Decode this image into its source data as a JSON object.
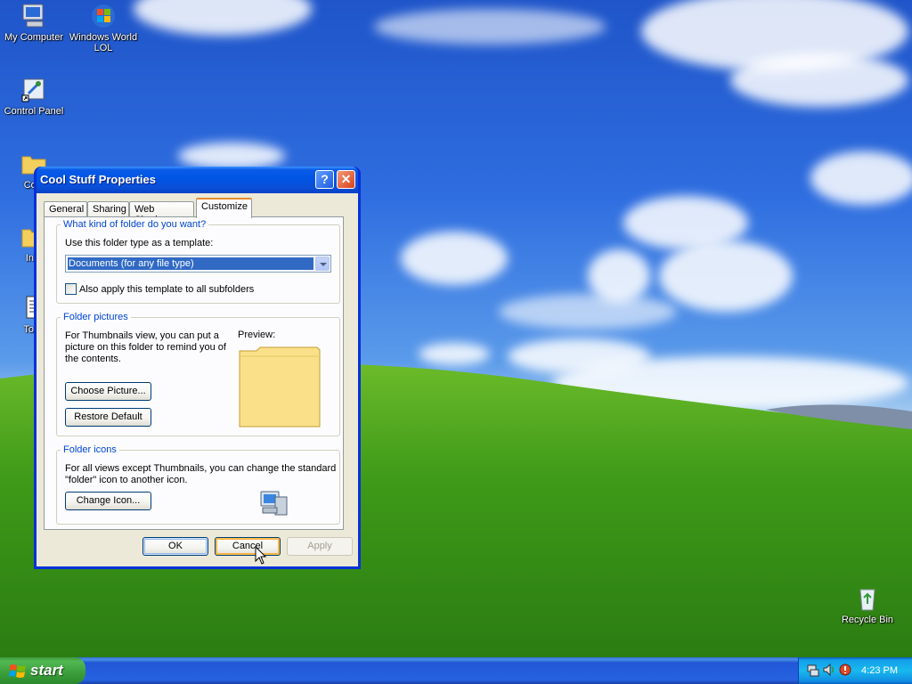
{
  "desktop": {
    "icons": [
      {
        "label": "My Computer",
        "icon": "my-computer-icon"
      },
      {
        "label": "Windows World LOL",
        "icon": "windows-logo-icon"
      },
      {
        "label": "Control Panel",
        "icon": "control-panel-icon"
      },
      {
        "label": "Cool",
        "icon": "folder-icon"
      },
      {
        "label": "Inte",
        "icon": "folder-icon"
      },
      {
        "label": "To-D",
        "icon": "text-document-icon"
      },
      {
        "label": "Recycle Bin",
        "icon": "recycle-bin-icon"
      }
    ]
  },
  "window": {
    "title": "Cool Stuff Properties",
    "help_glyph": "?",
    "close_glyph": "✕",
    "tabs": [
      {
        "label": "General",
        "active": false
      },
      {
        "label": "Sharing",
        "active": false
      },
      {
        "label": "Web Sharing",
        "active": false
      },
      {
        "label": "Customize",
        "active": true
      }
    ],
    "folder_type": {
      "legend": "What kind of folder do you want?",
      "template_label": "Use this folder type as a template:",
      "template_value": "Documents (for any file type)",
      "subfolders_label": "Also apply this template to all subfolders",
      "subfolders_checked": false
    },
    "folder_pictures": {
      "legend": "Folder pictures",
      "description": "For Thumbnails view, you can put a picture on this folder to remind you of the contents.",
      "choose_label": "Choose Picture...",
      "restore_label": "Restore Default",
      "preview_label": "Preview:"
    },
    "folder_icons": {
      "legend": "Folder icons",
      "description": "For all views except Thumbnails, you can change the standard \"folder\" icon to another icon.",
      "change_label": "Change Icon..."
    },
    "buttons": {
      "ok": "OK",
      "cancel": "Cancel",
      "apply": "Apply"
    }
  },
  "taskbar": {
    "start_label": "start",
    "clock": "4:23 PM"
  },
  "colors": {
    "title_bar": "#0055e5",
    "dialog_bg": "#ece9d8",
    "legend_text": "#0046d5",
    "selection": "#316ac5",
    "taskbar": "#2663e0",
    "start_button": "#3a9d3a"
  }
}
